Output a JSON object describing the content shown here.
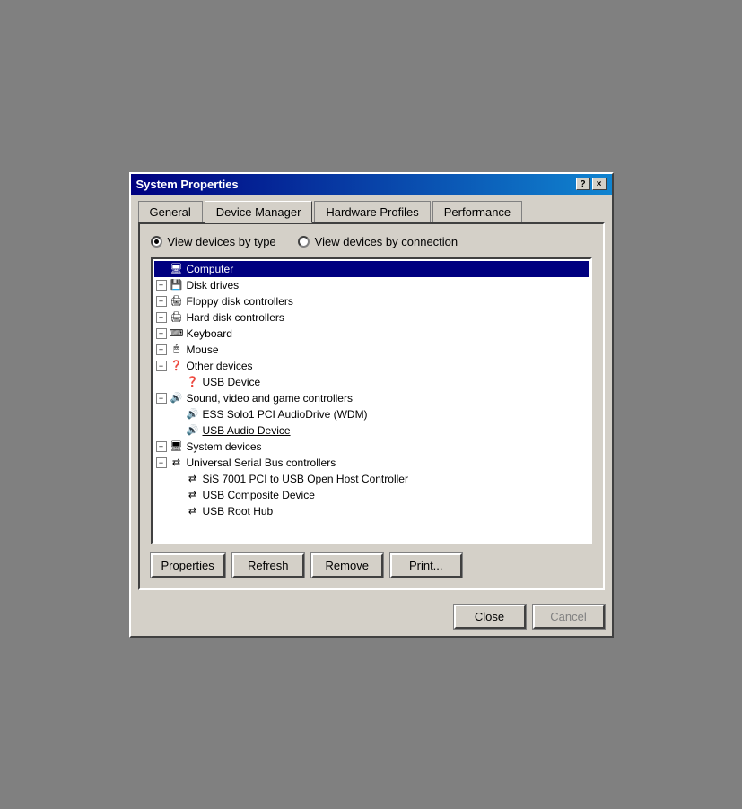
{
  "dialog": {
    "title": "System Properties",
    "title_btn_help": "?",
    "title_btn_close": "×"
  },
  "tabs": [
    {
      "id": "general",
      "label": "General",
      "active": false
    },
    {
      "id": "device-manager",
      "label": "Device Manager",
      "active": true
    },
    {
      "id": "hardware-profiles",
      "label": "Hardware Profiles",
      "active": false
    },
    {
      "id": "performance",
      "label": "Performance",
      "active": false
    }
  ],
  "radio": {
    "option1": {
      "label": "View devices by type",
      "checked": true
    },
    "option2": {
      "label": "View devices by connection",
      "checked": false
    }
  },
  "tree": {
    "items": [
      {
        "id": "computer",
        "label": "Computer",
        "level": 0,
        "expand": null,
        "icon": "computer",
        "selected": true
      },
      {
        "id": "disk-drives",
        "label": "Disk drives",
        "level": 0,
        "expand": "+",
        "icon": "disk"
      },
      {
        "id": "floppy",
        "label": "Floppy disk controllers",
        "level": 0,
        "expand": "+",
        "icon": "floppy"
      },
      {
        "id": "hdd",
        "label": "Hard disk controllers",
        "level": 0,
        "expand": "+",
        "icon": "hdd"
      },
      {
        "id": "keyboard",
        "label": "Keyboard",
        "level": 0,
        "expand": "+",
        "icon": "keyboard"
      },
      {
        "id": "mouse",
        "label": "Mouse",
        "level": 0,
        "expand": "+",
        "icon": "mouse"
      },
      {
        "id": "other-devices",
        "label": "Other devices",
        "level": 0,
        "expand": "-",
        "icon": "question"
      },
      {
        "id": "usb-device",
        "label": "USB Device",
        "level": 1,
        "expand": null,
        "icon": "question",
        "underline": true
      },
      {
        "id": "sound",
        "label": "Sound, video and game controllers",
        "level": 0,
        "expand": "-",
        "icon": "sound"
      },
      {
        "id": "ess-solo",
        "label": "ESS Solo1 PCI AudioDrive (WDM)",
        "level": 1,
        "expand": null,
        "icon": "sound"
      },
      {
        "id": "usb-audio",
        "label": "USB Audio Device",
        "level": 1,
        "expand": null,
        "icon": "sound",
        "underline": true
      },
      {
        "id": "system-devices",
        "label": "System devices",
        "level": 0,
        "expand": "+",
        "icon": "system"
      },
      {
        "id": "usb-controllers",
        "label": "Universal Serial Bus controllers",
        "level": 0,
        "expand": "-",
        "icon": "usb"
      },
      {
        "id": "sis-7001",
        "label": "SiS 7001 PCI to USB Open Host Controller",
        "level": 1,
        "expand": null,
        "icon": "usb"
      },
      {
        "id": "usb-composite",
        "label": "USB Composite Device",
        "level": 1,
        "expand": null,
        "icon": "usb",
        "underline": true
      },
      {
        "id": "usb-root-hub",
        "label": "USB Root Hub",
        "level": 1,
        "expand": null,
        "icon": "usb"
      }
    ]
  },
  "buttons": {
    "properties": "Properties",
    "refresh": "Refresh",
    "remove": "Remove",
    "print": "Print..."
  },
  "bottom_buttons": {
    "close": "Close",
    "cancel": "Cancel"
  }
}
